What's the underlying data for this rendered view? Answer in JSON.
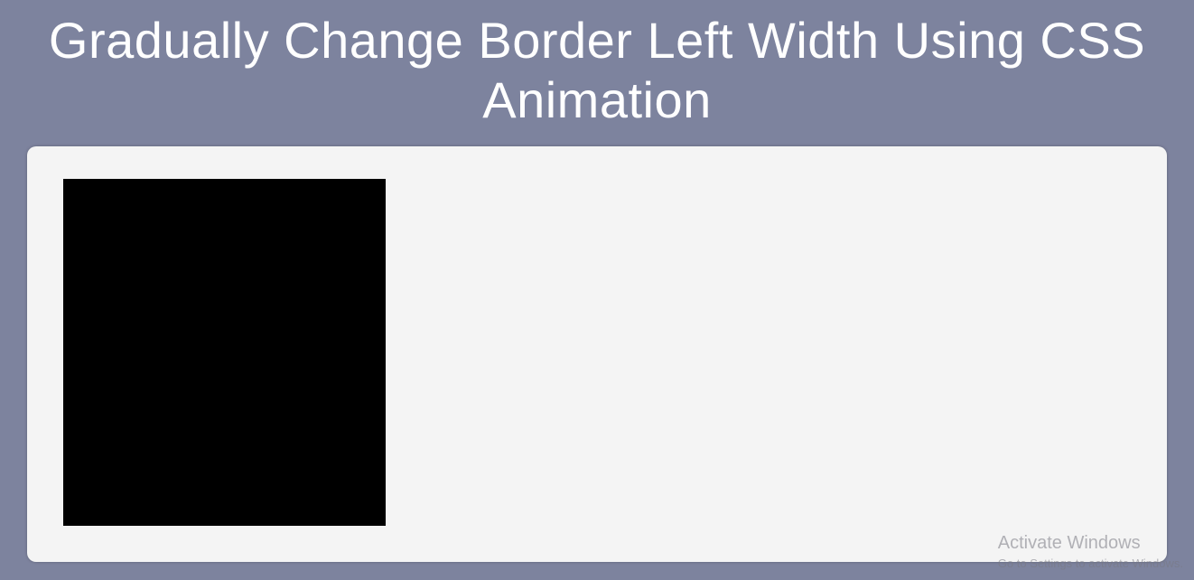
{
  "header": {
    "title": "Gradually Change Border Left Width Using CSS Animation"
  },
  "watermark": {
    "title": "Activate Windows",
    "subtitle": "Go to Settings to activate Windows."
  }
}
